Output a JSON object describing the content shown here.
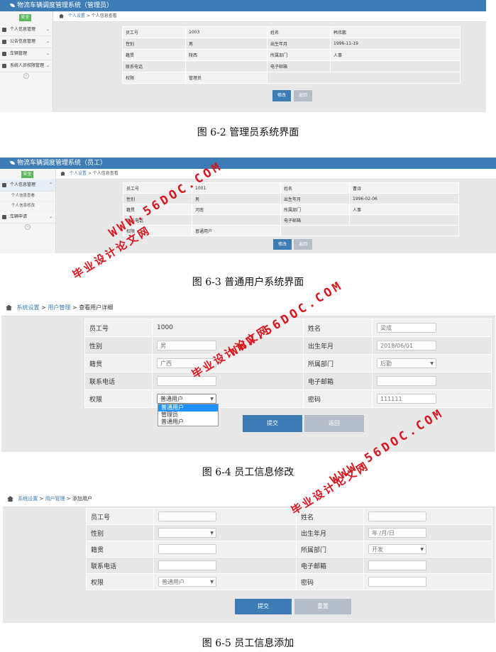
{
  "fig1": {
    "app_title": "物流车辆调度管理系统（管理员）",
    "exit_label": "安全",
    "menu": [
      "个人信息管理",
      "公告信息管理",
      "车辆管理",
      "系统人员权限管理"
    ],
    "breadcrumb": [
      "个人设置",
      "个人信息查看"
    ],
    "rows": [
      [
        "员工号",
        "1003",
        "姓名",
        "韩伟鹏"
      ],
      [
        "性别",
        "男",
        "出生年月",
        "1996-11-19"
      ],
      [
        "籍贯",
        "陕西",
        "所属部门",
        "人事"
      ],
      [
        "联系电话",
        "",
        "电子邮箱",
        ""
      ],
      [
        "权限",
        "管理员"
      ]
    ],
    "btn_modify": "修改",
    "btn_back": "返回",
    "caption": "图 6-2  管理员系统界面"
  },
  "fig2": {
    "app_title": "物流车辆调度管理系统（员工）",
    "exit_label": "安全",
    "menu_main": "个人信息管理",
    "submenu": [
      "个人信息查看",
      "个人信息修改"
    ],
    "menu_second": "车辆申请",
    "breadcrumb": [
      "个人设置",
      "个人信息查看"
    ],
    "rows": [
      [
        "员工号",
        "1001",
        "姓名",
        "曹诗"
      ],
      [
        "性别",
        "男",
        "出生年月",
        "1996-02-06"
      ],
      [
        "籍贯",
        "河南",
        "所属部门",
        "人事"
      ],
      [
        "联系电话",
        "",
        "电子邮箱",
        ""
      ],
      [
        "权限",
        "普通用户"
      ]
    ],
    "btn_modify": "修改",
    "btn_back": "返回",
    "caption": "图 6-3  普通用户系统界面"
  },
  "fig3": {
    "breadcrumb": [
      "系统设置",
      "用户管理",
      "查看用户详细"
    ],
    "labels": {
      "emp_no": "员工号",
      "name": "姓名",
      "gender": "性别",
      "birth": "出生年月",
      "native": "籍贯",
      "dept": "所属部门",
      "phone": "联系电话",
      "email": "电子邮箱",
      "perm": "权限",
      "password": "密码"
    },
    "values": {
      "emp_no": "1000",
      "name": "梁成",
      "gender": "男",
      "birth": "2018/06/01",
      "native": "广西",
      "dept": "后勤",
      "phone": "",
      "email": "",
      "perm": "普通用户",
      "password": "111111"
    },
    "perm_options": [
      "普通用户",
      "管理员",
      "普通用户"
    ],
    "btn_submit": "提交",
    "btn_back": "返回",
    "caption": "图 6-4  员工信息修改"
  },
  "fig4": {
    "breadcrumb": [
      "系统设置",
      "用户管理",
      "添加用户"
    ],
    "labels": {
      "emp_no": "员工号",
      "name": "姓名",
      "gender": "性别",
      "birth": "出生年月",
      "native": "籍贯",
      "dept": "所属部门",
      "phone": "联系电话",
      "email": "电子邮箱",
      "perm": "权限",
      "password": "密码"
    },
    "values": {
      "birth": "年 /月/日",
      "dept": "开发",
      "perm": "普通用户"
    },
    "btn_submit": "提交",
    "btn_reset": "重置",
    "caption": "图 6-5  员工信息添加"
  },
  "watermarks": {
    "url": "WWW.56DOC.COM",
    "cn": "毕业设计论文网"
  }
}
